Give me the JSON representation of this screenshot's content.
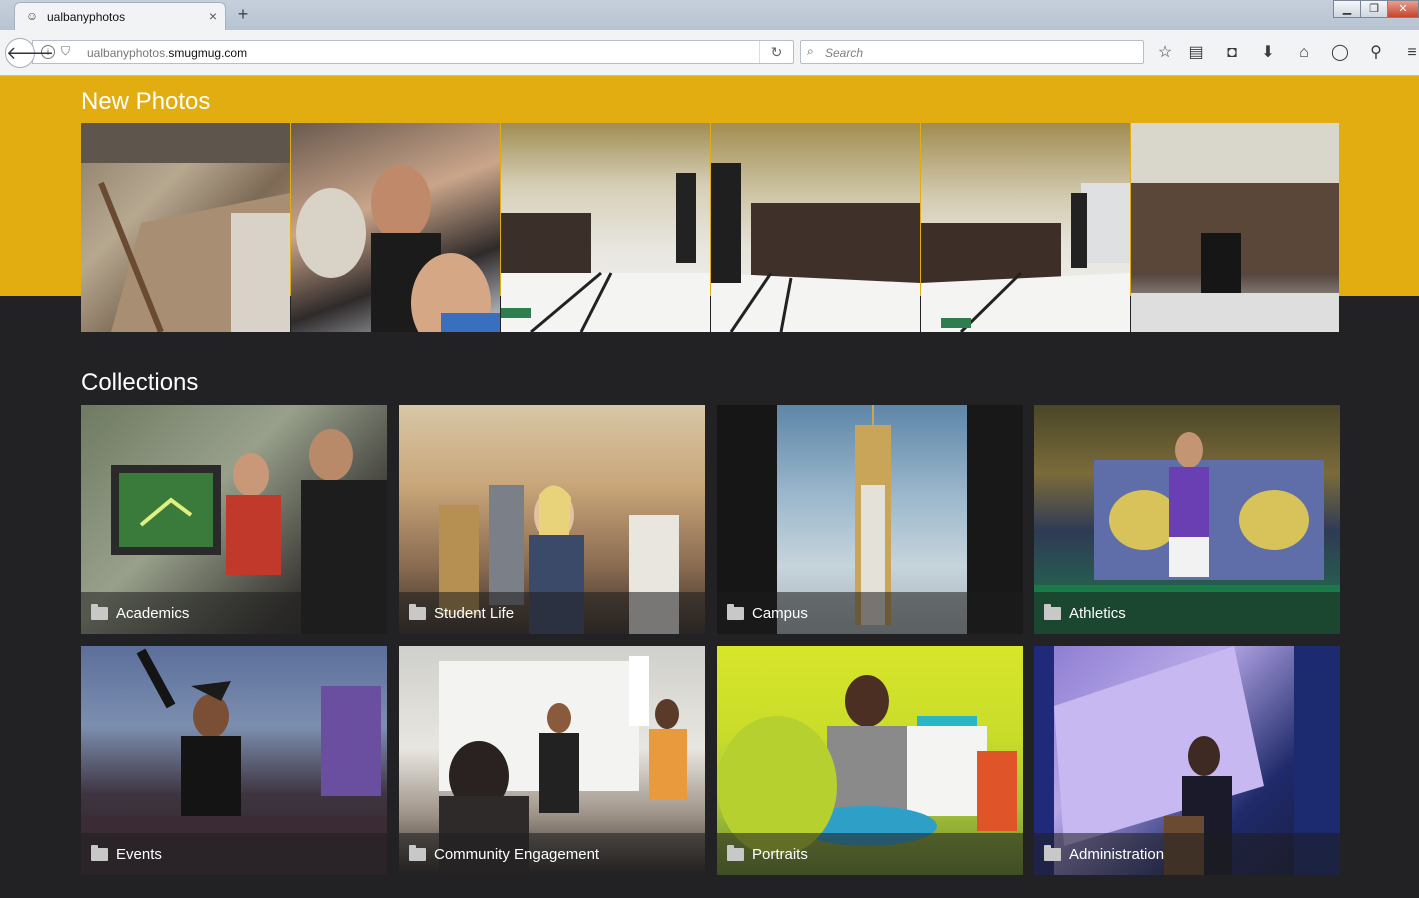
{
  "browser": {
    "tab_title": "ualbanyphotos",
    "tab_close": "×",
    "new_tab": "+",
    "url_prefix": "ualbanyphotos.",
    "url_domain": "smugmug.com",
    "search_placeholder": "Search",
    "window_controls": [
      "▁",
      "❐",
      "✕"
    ],
    "toolbar_icons": [
      "star-icon",
      "reading-list-icon",
      "pocket-icon",
      "download-icon",
      "home-icon",
      "chat-icon",
      "wand-icon",
      "menu-icon"
    ]
  },
  "page": {
    "new_photos_title": "New Photos",
    "collections_title": "Collections",
    "new_photos_count": 6,
    "collections": [
      {
        "label": "Academics"
      },
      {
        "label": "Student Life"
      },
      {
        "label": "Campus"
      },
      {
        "label": "Athletics"
      },
      {
        "label": "Events"
      },
      {
        "label": "Community Engagement"
      },
      {
        "label": "Portraits"
      },
      {
        "label": "Administration"
      }
    ]
  },
  "colors": {
    "hero_band": "#e1ad10",
    "page_background": "#222224",
    "text": "#ffffff"
  }
}
